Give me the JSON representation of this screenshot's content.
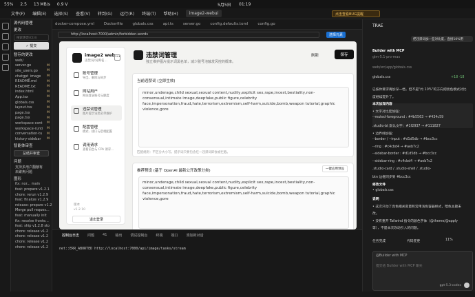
{
  "system": {
    "battery": "55%",
    "cpu": "2.5",
    "net": "13 MB/s",
    "temp": "0.9 V",
    "date": "5月5日",
    "time": "01:19"
  },
  "menu": {
    "items": [
      "文件(F)",
      "编辑(E)",
      "选择(S)",
      "查看(V)",
      "转到(G)",
      "运行(R)",
      "终端(T)",
      "帮助(H)"
    ],
    "current": "image2-webui",
    "notice": "点击查看BUG提醒"
  },
  "left": {
    "title": "源代码管理",
    "changes": "更改",
    "search_placeholder": "搜索更改(Ctrl)",
    "commit": "✓ 提交",
    "commit_hint": "Ctrl+Enter",
    "staged": "暂存的更改",
    "files": [
      {
        "name": "web/",
        "mark": ""
      },
      {
        "name": "server.go",
        "mark": "M"
      },
      {
        "name": "site_users.go",
        "mark": "M"
      },
      {
        "name": "chatgpt_image",
        "mark": "M"
      },
      {
        "name": "README.md",
        "mark": "M"
      },
      {
        "name": "README.txt",
        "mark": "M"
      },
      {
        "name": "index.html",
        "mark": "M"
      },
      {
        "name": "App.tsx",
        "mark": "M"
      },
      {
        "name": "globals.css",
        "mark": "M"
      },
      {
        "name": "layout.tsx",
        "mark": "M"
      },
      {
        "name": "page.tsx",
        "mark": "M"
      },
      {
        "name": "page.tsx",
        "mark": "M"
      },
      {
        "name": "workspace-cont",
        "mark": "M"
      },
      {
        "name": "workspace-runti",
        "mark": "M"
      },
      {
        "name": "conversation-tu",
        "mark": "M"
      },
      {
        "name": "history-sidebar",
        "mark": "M"
      }
    ],
    "review": "智能体审查",
    "review_btn": "总结并审查",
    "problems": "问题",
    "problem_item": "支持多用户翻蔽有",
    "problem_sub": "未聚焦问题",
    "graph": "图形",
    "commits": [
      "fix: nor... main",
      "feat: prepare v1.2.1",
      "chore: rerun v1.2.9",
      "feat: finalize v1.2.9",
      "release: prepare v1.2",
      "Merge pull reques...",
      "feat: manually init",
      "fix: resolve fronte...",
      "feat: ship v1.2.8 sto",
      "chore: release v1.2",
      "chore: release v1.2",
      "chore: release v1.2",
      "chore: release v1.2"
    ]
  },
  "tabs": [
    "docker-compose.yml",
    "Dockerfile",
    "globals.css",
    "api.ts",
    "server.go",
    "config.defaults.toml",
    "config.go"
  ],
  "browser": {
    "url": "http://localhost:7000/admin/forbidden-words",
    "choose": "选择元素"
  },
  "app": {
    "brand": "image2 web...",
    "brand_sub": "违禁词/词库名...",
    "nav": [
      {
        "title": "账号管理",
        "sub": "导出、删除与同步"
      },
      {
        "title": "网站用户",
        "sub": "网站登录账号与额度"
      },
      {
        "title": "违禁词管理",
        "sub": "图片提示词黑名单维护"
      },
      {
        "title": "配置管理",
        "sub": "模式、接口与后端配置"
      },
      {
        "title": "调用请求",
        "sub": "查看前台与 CPA 请求..."
      }
    ],
    "version_label": "版本",
    "version": "v1.2.10",
    "logout": "退出登录",
    "page_title": "违禁词管理",
    "page_sub": "独立维护图片提示词黑名单，减少脱号池触发风控的概率。",
    "refresh": "刷新",
    "save": "保存",
    "current_title": "当前违禁词 (立即生效)",
    "current_words": "minor,underage,child sexual,sexual content,nudity,explicit sex,rape,incest,bestiality,non-consensual,intimate image,deepfake,public figure,celebrity face,impersonation,fraud,hate,terrorism,extremism,self-harm,suicide,bomb,weapon tutorial,graphic violence,gore",
    "current_hint": "匹配规则：不区分大小写，提示词只要包含任一违禁词即会被拦截。",
    "preset_title": "推荐预设 (基于 OpenAI 最新公开政策分类)",
    "preset_btn": "一键应用预设",
    "preset_words": "minor,underage,child sexual,sexual content,nudity,explicit sex,rape,incest,bestiality,non-consensual,intimate image,deepfake,public figure,celebrity face,impersonation,fraud,hate,terrorism,extremism,self-harm,suicide,bomb,weapon tutorial,graphic violence,gore"
  },
  "panel": {
    "tabs": [
      "控制台日志",
      "问题",
      "输出",
      "调试控制台",
      "终端",
      "端口"
    ],
    "problems_count": "41",
    "new_conv": "添加新对话",
    "log": "net::ERR_ABORTED http://localhost:7000/api/image/tasks/stream"
  },
  "right": {
    "title": "TRAE",
    "user_msg": "把违禁词加一些对比度，直接10%用",
    "agent": "Builder with MCP",
    "model": "glm-5.1-pro-max",
    "path": "web/src/app/globals.css",
    "file": "globals.css",
    "diff": "+18 -18",
    "lines": [
      "已按你要求再加深一档，但不是\"约 10%\"的方向把亮色模式对比",
      "度继续提升了。",
      "本次加深内容",
      "• 文字对比度加强：",
      "  --muted-foreground : #4b5563 → #434c59",
      "  .studio-bt 默认文字：#1f2937 → #111827",
      "• 边界线加强：",
      "  --border / --input : #d1d5db → #bcc3cc",
      "  --ring : #c4cbd4 → #aeb7c2",
      "  --sidebar-border : #d1d5db → #bcc3cc",
      "  --sidebar-ring : #c4cbd4 → #aeb7c2",
      "  .studio-card / .studio-shell / .studio-",
      "  btn 边框同步到 #bcc3cc",
      "修改文件",
      "• globals.css",
      "说明",
      "• 这次只动了亮色相关变量和常用浅色容器样式，暗色主题未",
      "  改。",
      "• 没有重开 Tailwind 指令的颜色字体（@theme/@apply",
      "  等），不是本次改动引入的问题。"
    ],
    "tasks": "任务完成",
    "summary": "代码变更",
    "percent": "11%",
    "input_head": "@Builder with MCP",
    "input_ph": "提交给 Builder with MCP 聊天",
    "model_sel": "gpt-5.3-codex"
  }
}
